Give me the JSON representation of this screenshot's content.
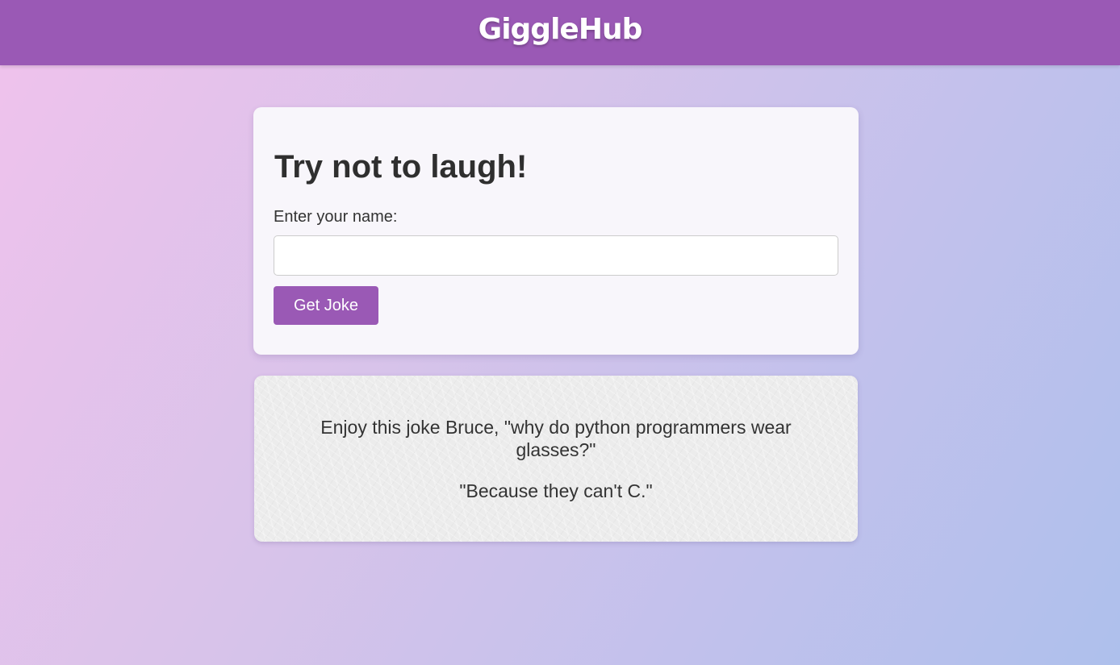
{
  "header": {
    "logo_text": "GiggleHub",
    "background_color": "#9a59b5"
  },
  "form": {
    "title": "Try not to laugh!",
    "name_label": "Enter your name:",
    "name_value": "",
    "name_placeholder": "",
    "button_label": "Get Joke",
    "button_color": "#9a59b5"
  },
  "joke": {
    "setup": "Enjoy this joke Bruce, \"why do python programmers wear glasses?\"",
    "punchline": "\"Because they can't C.\""
  }
}
